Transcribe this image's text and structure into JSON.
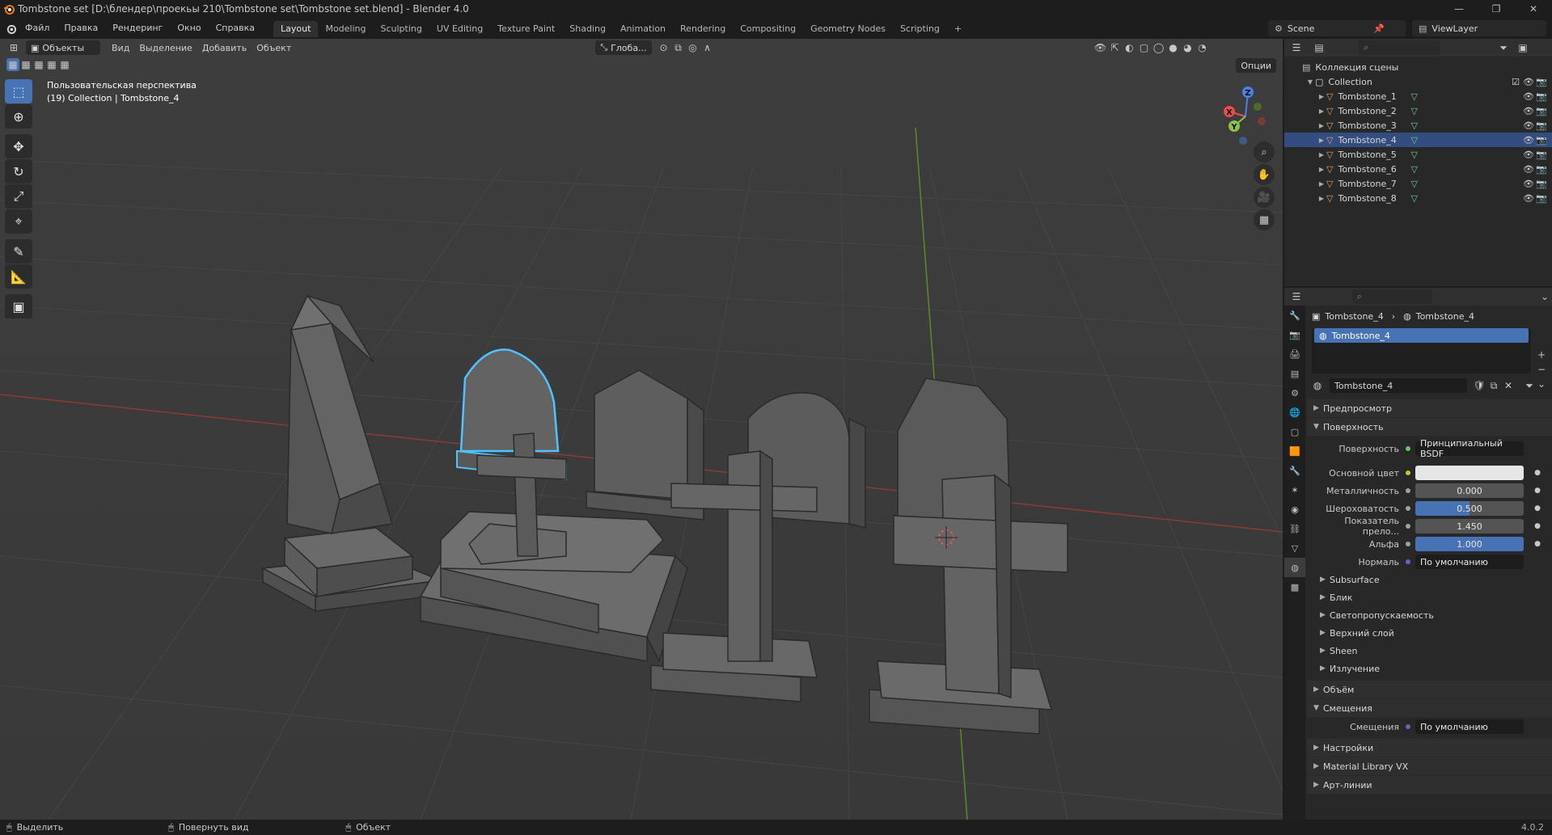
{
  "window": {
    "title": "Tombstone set [D:\\блендер\\проекьы 210\\Tombstone set\\Tombstone set.blend] - Blender 4.0",
    "min": "—",
    "max": "❐",
    "close": "✕"
  },
  "menubar": {
    "menus": [
      "Файл",
      "Правка",
      "Рендеринг",
      "Окно",
      "Справка"
    ],
    "workspaces": [
      "Layout",
      "Modeling",
      "Sculpting",
      "UV Editing",
      "Texture Paint",
      "Shading",
      "Animation",
      "Rendering",
      "Compositing",
      "Geometry Nodes",
      "Scripting"
    ],
    "active_workspace": "Layout",
    "add_tab": "+",
    "scene": "Scene",
    "view_layer": "ViewLayer"
  },
  "viewport": {
    "mode": "Объекты",
    "menus": [
      "Вид",
      "Выделение",
      "Добавить",
      "Объект"
    ],
    "transform_orientation": "Глоба...",
    "options": "Опции",
    "info_line1": "Пользовательская перспектива",
    "info_line2": "(19) Collection | Tombstone_4",
    "gizmo": {
      "x": "X",
      "y": "Y",
      "z": "Z"
    }
  },
  "outliner": {
    "root": "Коллекция сцены",
    "collection": "Collection",
    "objects": [
      "Tombstone_1",
      "Tombstone_2",
      "Tombstone_3",
      "Tombstone_4",
      "Tombstone_5",
      "Tombstone_6",
      "Tombstone_7",
      "Tombstone_8"
    ],
    "selected": "Tombstone_4"
  },
  "properties": {
    "breadcrumb_object": "Tombstone_4",
    "breadcrumb_material": "Tombstone_4",
    "slot_name": "Tombstone_4",
    "material_name": "Tombstone_4",
    "sections": {
      "preview": "Предпросмотр",
      "surface": "Поверхность",
      "volume": "Объём",
      "displacement": "Смещения",
      "settings": "Настройки",
      "material_library": "Material Library VX",
      "lineart": "Арт-линии"
    },
    "surface": {
      "surface_label": "Поверхность",
      "surface_value": "Принципиальный BSDF",
      "base_color_label": "Основной цвет",
      "base_color": "#e6e6e6",
      "metallic_label": "Металличность",
      "metallic": "0.000",
      "roughness_label": "Шероховатость",
      "roughness": "0.500",
      "ior_label": "Показатель прело...",
      "ior": "1.450",
      "alpha_label": "Альфа",
      "alpha": "1.000",
      "normal_label": "Нормаль",
      "normal": "По умолчанию",
      "subsections": [
        "Subsurface",
        "Блик",
        "Светопропускаемость",
        "Верхний слой",
        "Sheen",
        "Излучение"
      ]
    },
    "displacement": {
      "label": "Смещения",
      "value": "По умолчанию"
    }
  },
  "statusbar": {
    "select": "Выделить",
    "rotate": "Повернуть вид",
    "object": "Объект",
    "version": "4.0.2"
  }
}
